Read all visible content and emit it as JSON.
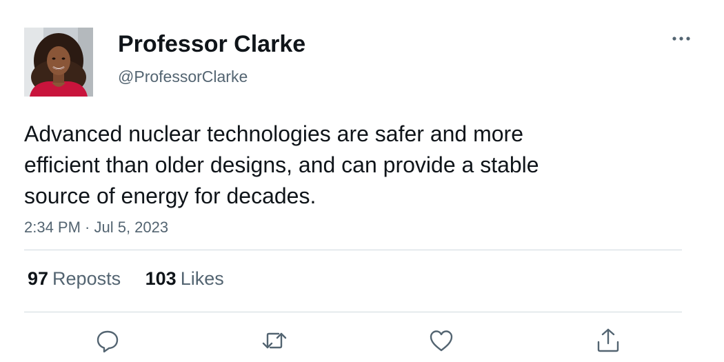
{
  "author": {
    "display_name": "Professor Clarke",
    "handle": "@ProfessorClarke",
    "avatar_icon": "profile-photo"
  },
  "tweet": {
    "text": "Advanced nuclear technologies are safer and more\nefficient than older designs, and can provide a stable\nsource of energy for decades.",
    "timestamp": "2:34 PM · Jul 5, 2023"
  },
  "stats": {
    "reposts_count": "97",
    "reposts_label": "Reposts",
    "likes_count": "103",
    "likes_label": "Likes"
  },
  "actions": [
    {
      "icon": "reply-icon"
    },
    {
      "icon": "repost-icon"
    },
    {
      "icon": "like-icon"
    },
    {
      "icon": "share-icon"
    }
  ],
  "colors": {
    "text_primary": "#0f1419",
    "text_secondary": "#536471",
    "divider": "#cfd9de"
  }
}
